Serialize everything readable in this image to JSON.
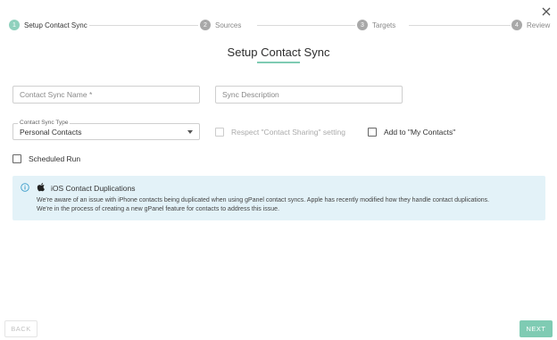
{
  "window": {
    "close_icon": "close-icon"
  },
  "stepper": {
    "steps": [
      {
        "number": "1",
        "label": "Setup Contact Sync",
        "state": "active"
      },
      {
        "number": "2",
        "label": "Sources",
        "state": "inactive"
      },
      {
        "number": "3",
        "label": "Targets",
        "state": "inactive"
      },
      {
        "number": "4",
        "label": "Review",
        "state": "inactive"
      }
    ]
  },
  "page": {
    "title": "Setup Contact Sync"
  },
  "form": {
    "name_placeholder": "Contact Sync Name *",
    "description_placeholder": "Sync Description",
    "type_label": "Contact Sync Type",
    "type_value": "Personal Contacts",
    "respect_sharing_label": "Respect \"Contact Sharing\" setting",
    "add_to_my_contacts_label": "Add to \"My Contacts\"",
    "scheduled_run_label": "Scheduled Run"
  },
  "banner": {
    "title": "iOS Contact Duplications",
    "line1": "We're aware of an issue with iPhone contacts being duplicated when using gPanel contact syncs. Apple has recently modified how they handle contact duplications.",
    "line2": "We're in the process of creating a new gPanel feature for contacts to address this issue."
  },
  "buttons": {
    "back": "BACK",
    "next": "NEXT"
  },
  "colors": {
    "accent": "#7fcbb3",
    "step_active": "#8fd1bd",
    "step_inactive": "#a8a8a8",
    "banner_bg": "#e3f2f8",
    "info_icon": "#3a9cc9"
  }
}
